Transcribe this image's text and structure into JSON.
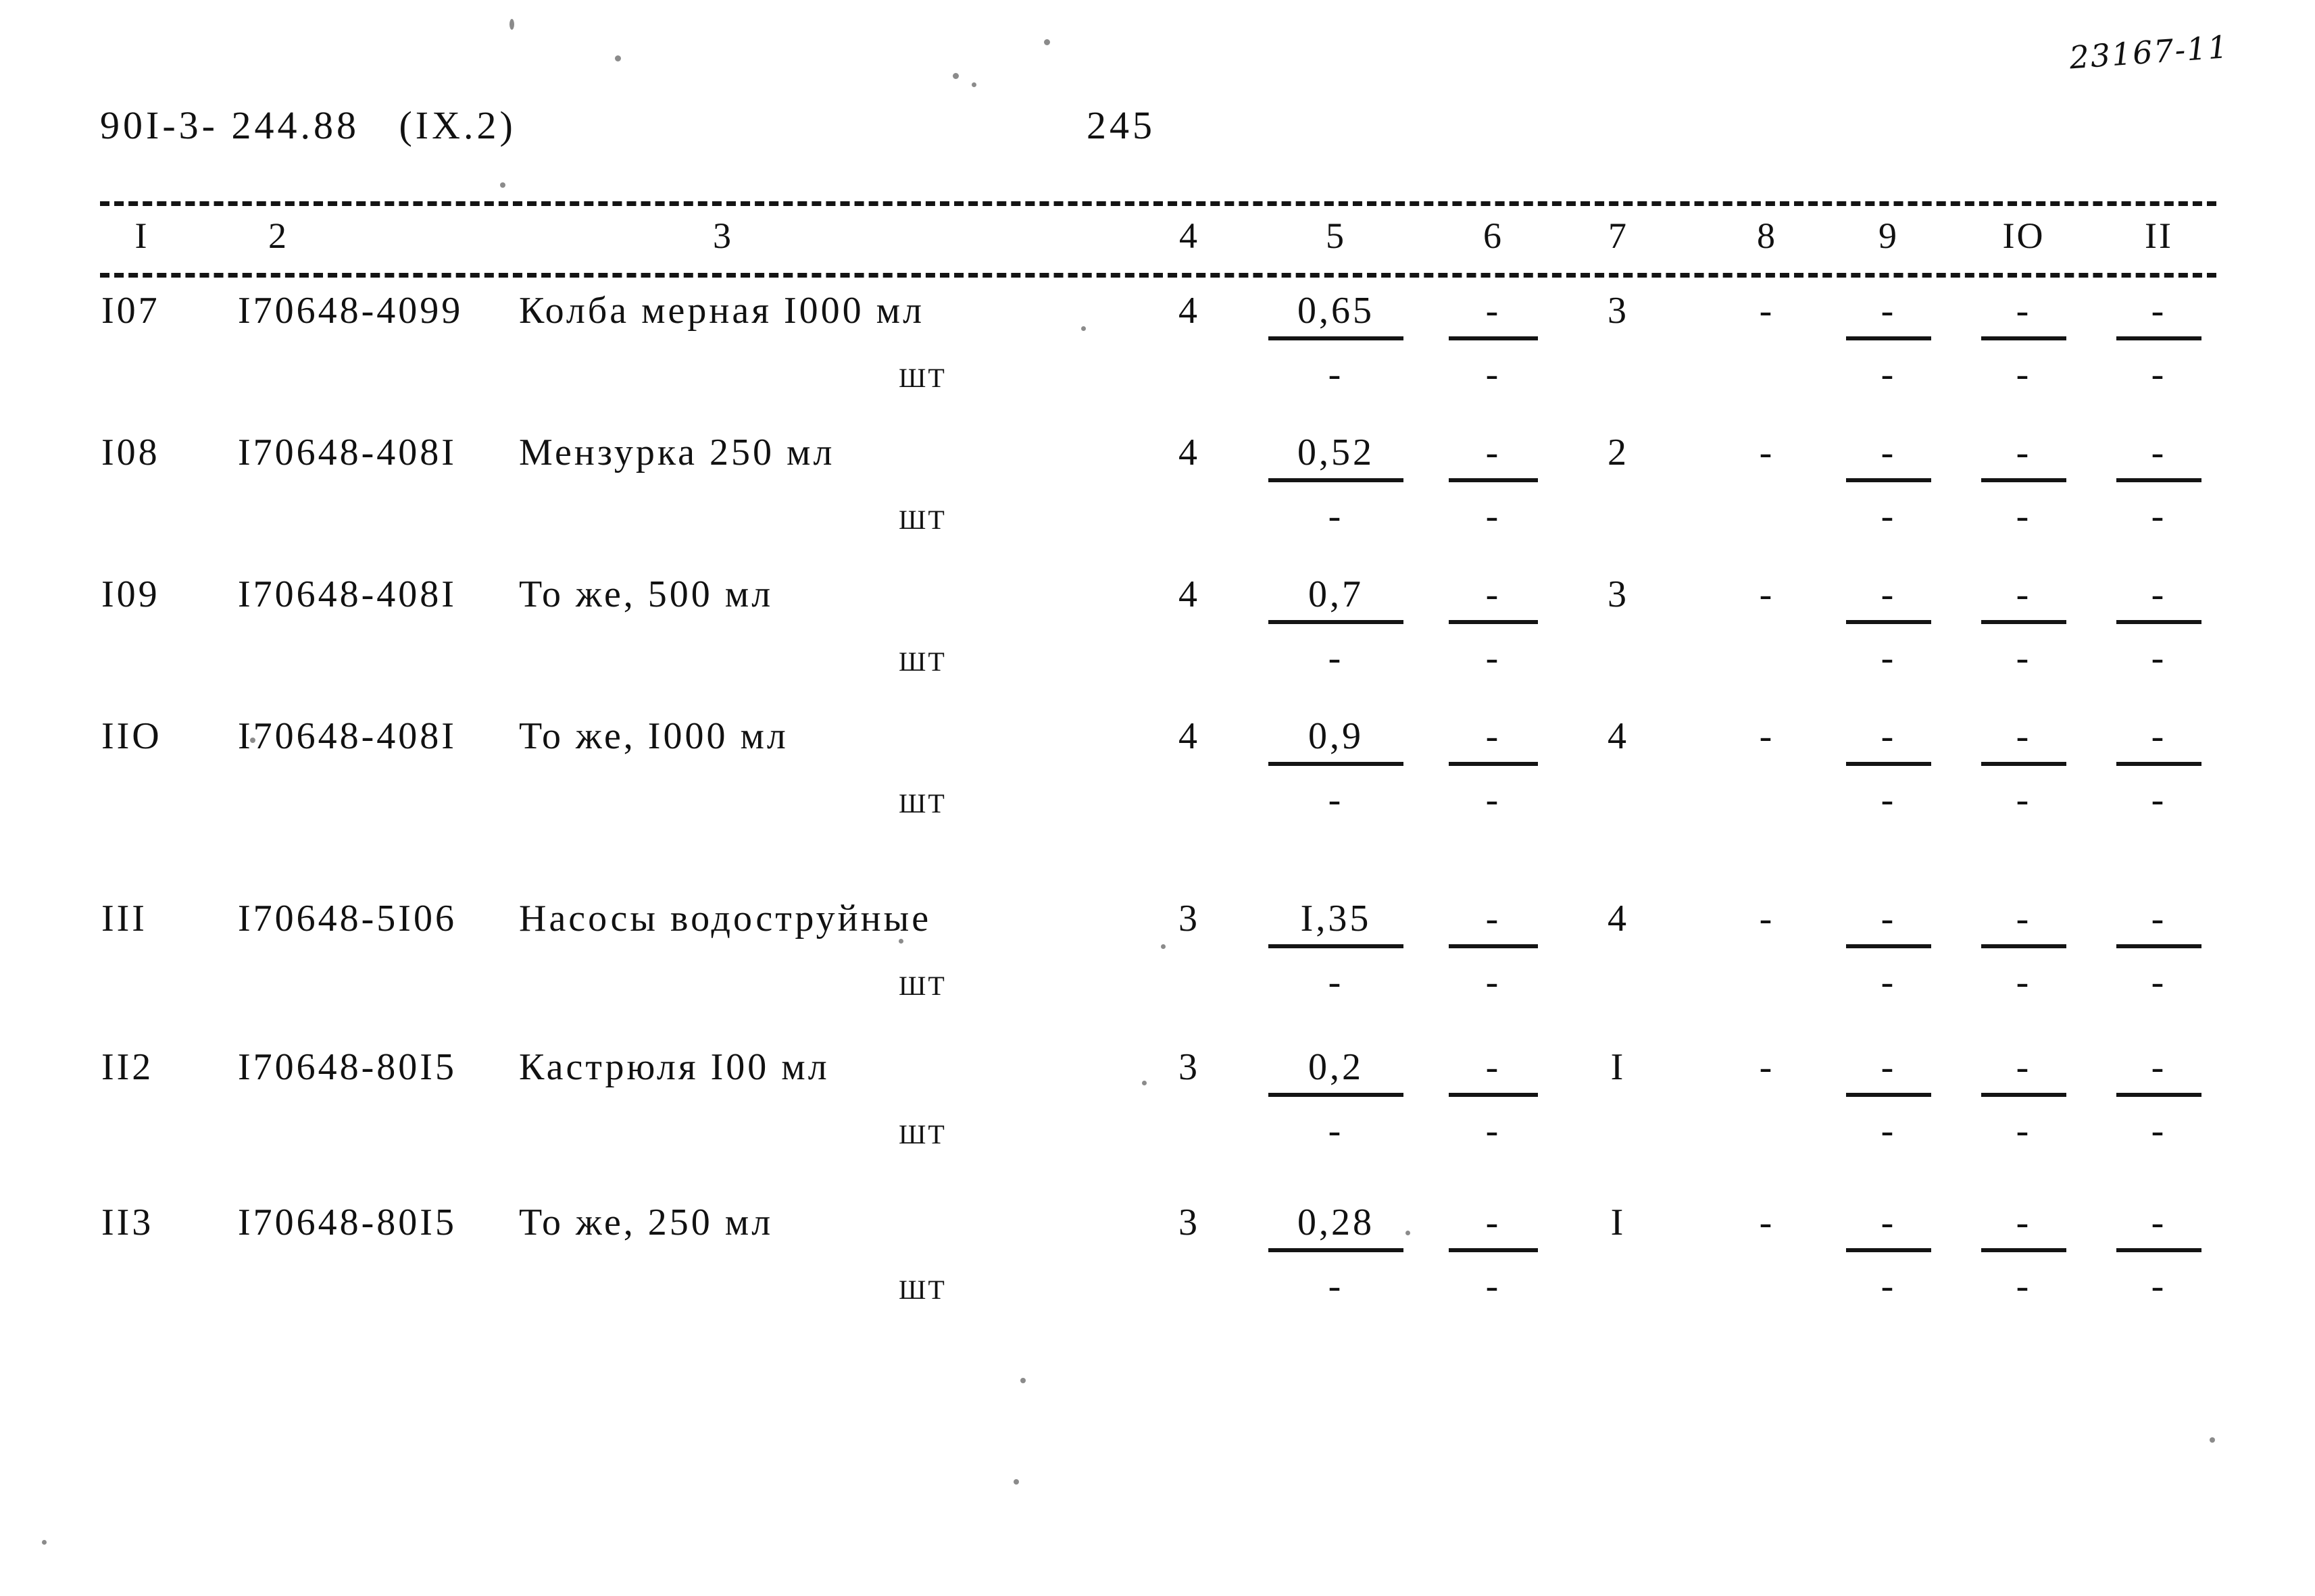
{
  "header": {
    "doc_code": "90I-3- 244.88   (IX.2)",
    "page_number": "245",
    "archive_mark": "23167-11"
  },
  "table": {
    "column_headers": [
      "I",
      "2",
      "3",
      "4",
      "5",
      "6",
      "7",
      "8",
      "9",
      "IO",
      "II"
    ],
    "unit_label": "ШТ",
    "rows": [
      {
        "no": "I07",
        "code": "I70648-4099",
        "description": "Колба мерная I000 мл",
        "unit": "ШТ",
        "qty": "4",
        "col5_num": "0,65",
        "col5_den": "-",
        "col6_num": "-",
        "col6_den": "-",
        "col7": "3",
        "col8": "-",
        "col9_num": "-",
        "col9_den": "-",
        "col10_num": "-",
        "col10_den": "-",
        "col11_num": "-",
        "col11_den": "-"
      },
      {
        "no": "I08",
        "code": "I70648-408I",
        "description": "Мензурка 250 мл",
        "unit": "ШТ",
        "qty": "4",
        "col5_num": "0,52",
        "col5_den": "-",
        "col6_num": "-",
        "col6_den": "-",
        "col7": "2",
        "col8": "-",
        "col9_num": "-",
        "col9_den": "-",
        "col10_num": "-",
        "col10_den": "-",
        "col11_num": "-",
        "col11_den": "-"
      },
      {
        "no": "I09",
        "code": "I70648-408I",
        "description": "То же, 500 мл",
        "unit": "ШТ",
        "qty": "4",
        "col5_num": "0,7",
        "col5_den": "-",
        "col6_num": "-",
        "col6_den": "-",
        "col7": "3",
        "col8": "-",
        "col9_num": "-",
        "col9_den": "-",
        "col10_num": "-",
        "col10_den": "-",
        "col11_num": "-",
        "col11_den": "-"
      },
      {
        "no": "IIO",
        "code": "I70648-408I",
        "description": "То же, I000 мл",
        "unit": "ШТ",
        "qty": "4",
        "col5_num": "0,9",
        "col5_den": "-",
        "col6_num": "-",
        "col6_den": "-",
        "col7": "4",
        "col8": "-",
        "col9_num": "-",
        "col9_den": "-",
        "col10_num": "-",
        "col10_den": "-",
        "col11_num": "-",
        "col11_den": "-"
      },
      {
        "no": "III",
        "code": "I70648-5I06",
        "description": "Насосы водоструйные",
        "unit": "ШТ",
        "qty": "3",
        "col5_num": "I,35",
        "col5_den": "-",
        "col6_num": "-",
        "col6_den": "-",
        "col7": "4",
        "col8": "-",
        "col9_num": "-",
        "col9_den": "-",
        "col10_num": "-",
        "col10_den": "-",
        "col11_num": "-",
        "col11_den": "-"
      },
      {
        "no": "II2",
        "code": "I70648-80I5",
        "description": "Кастрюля I00 мл",
        "unit": "ШТ",
        "qty": "3",
        "col5_num": "0,2",
        "col5_den": "-",
        "col6_num": "-",
        "col6_den": "-",
        "col7": "I",
        "col8": "-",
        "col9_num": "-",
        "col9_den": "-",
        "col10_num": "-",
        "col10_den": "-",
        "col11_num": "-",
        "col11_den": "-"
      },
      {
        "no": "II3",
        "code": "I70648-80I5",
        "description": "То же, 250 мл",
        "unit": "ШТ",
        "qty": "3",
        "col5_num": "0,28",
        "col5_den": "-",
        "col6_num": "-",
        "col6_den": "-",
        "col7": "I",
        "col8": "-",
        "col9_num": "-",
        "col9_den": "-",
        "col10_num": "-",
        "col10_den": "-",
        "col11_num": "-",
        "col11_den": "-"
      }
    ]
  }
}
